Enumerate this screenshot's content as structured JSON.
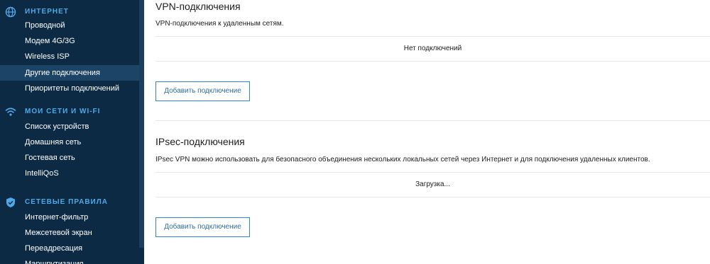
{
  "sidebar": {
    "sections": [
      {
        "title": "ИНТЕРНЕТ",
        "icon": "globe-icon",
        "items": [
          {
            "label": "Проводной"
          },
          {
            "label": "Модем 4G/3G"
          },
          {
            "label": "Wireless ISP"
          },
          {
            "label": "Другие подключения",
            "active": true
          },
          {
            "label": "Приоритеты подключений"
          }
        ]
      },
      {
        "title": "МОИ СЕТИ И WI-FI",
        "icon": "wifi-icon",
        "items": [
          {
            "label": "Список устройств"
          },
          {
            "label": "Домашняя сеть"
          },
          {
            "label": "Гостевая сеть"
          },
          {
            "label": "IntelliQoS"
          }
        ]
      },
      {
        "title": "СЕТЕВЫЕ ПРАВИЛА",
        "icon": "shield-icon",
        "items": [
          {
            "label": "Интернет-фильтр"
          },
          {
            "label": "Межсетевой экран"
          },
          {
            "label": "Переадресация"
          },
          {
            "label": "Маршрутизация"
          }
        ]
      }
    ]
  },
  "main": {
    "vpn": {
      "title": "VPN-подключения",
      "description": "VPN-подключения к удаленным сетям.",
      "status": "Нет подключений",
      "add_button": "Добавить подключение"
    },
    "ipsec": {
      "title": "IPsec-подключения",
      "description": "IPsec VPN можно использовать для безопасного объединения нескольких локальных сетей через Интернет и для подключения удаленных клиентов.",
      "status": "Загрузка...",
      "add_button": "Добавить подключение"
    }
  },
  "colors": {
    "sidebar_bg": "#0c2a44",
    "sidebar_active": "#1c4466",
    "accent": "#4fa9e8",
    "button_border": "#2f86c8"
  }
}
